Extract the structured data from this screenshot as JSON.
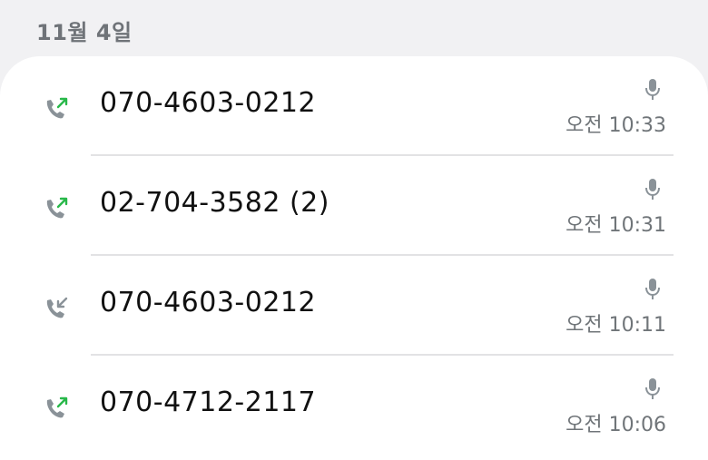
{
  "date_header": "11월 4일",
  "colors": {
    "outgoing_arrow": "#29b84a",
    "incoming_arrow": "#8a9298",
    "phone_icon": "#8a9298",
    "time_text": "#707579"
  },
  "calls": [
    {
      "number": "070-4603-0212",
      "time": "오전 10:33",
      "direction": "outgoing",
      "icon": "outgoing-call-icon",
      "recording_icon": "mic-icon"
    },
    {
      "number": "02-704-3582 (2)",
      "time": "오전 10:31",
      "direction": "outgoing",
      "icon": "outgoing-call-icon",
      "recording_icon": "mic-icon"
    },
    {
      "number": "070-4603-0212",
      "time": "오전 10:11",
      "direction": "incoming",
      "icon": "incoming-call-icon",
      "recording_icon": "mic-icon"
    },
    {
      "number": "070-4712-2117",
      "time": "오전 10:06",
      "direction": "outgoing",
      "icon": "outgoing-call-icon",
      "recording_icon": "mic-icon"
    }
  ]
}
